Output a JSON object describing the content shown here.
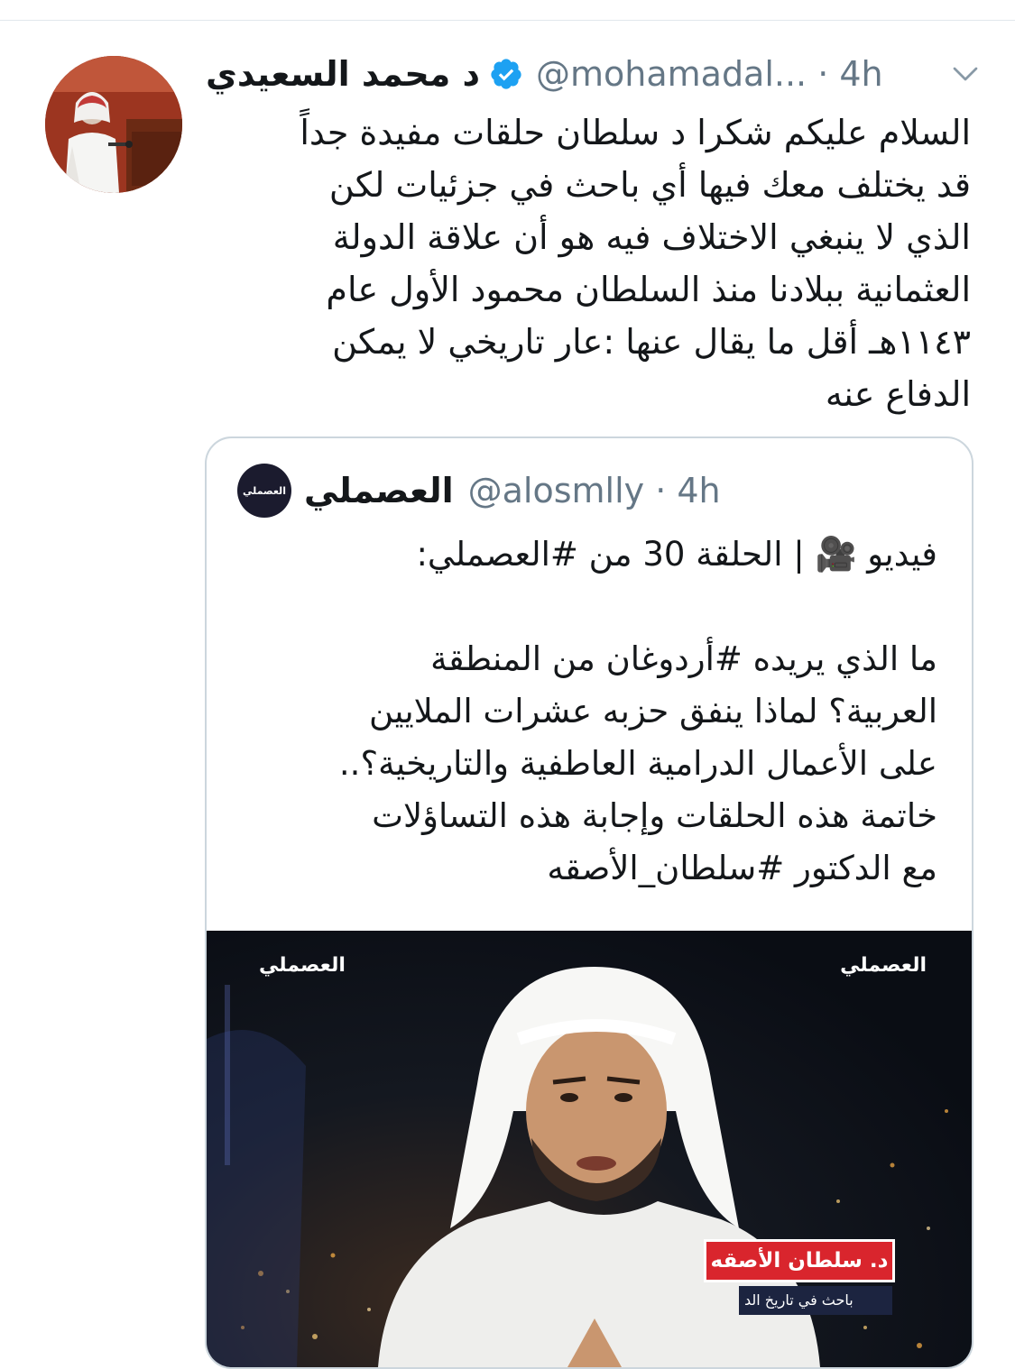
{
  "tweet": {
    "display_name": "د محمد السعيدي",
    "handle_time": "@mohamadal... · 4h",
    "text": "السلام عليكم شكرا د سلطان حلقات مفيدة جداً\nقد يختلف معك فيها أي باحث في جزئيات لكن\nالذي لا ينبغي الاختلاف فيه هو أن علاقة الدولة\nالعثمانية ببلادنا منذ السلطان محمود الأول عام\n١١٤٣هـ أقل ما يقال عنها :عار تاريخي لا يمكن\nالدفاع عنه",
    "verified_icon": "verified-badge-icon",
    "menu_icon": "chevron-down-icon"
  },
  "quote": {
    "display_name": "العصملي",
    "handle_time": "@alosmlly · 4h",
    "avatar_text": "العصملي",
    "text": "فيديو 🎥 | الحلقة 30 من #العصملي:\n\nما الذي يريده #أردوغان من المنطقة\nالعربية؟ لماذا ينفق حزبه عشرات الملايين\nعلى الأعمال الدرامية العاطفية والتاريخية؟..\nخاتمة هذه الحلقات وإجابة هذه التساؤلات\nمع الدكتور #سلطان_الأصقه",
    "media": {
      "logo_left": "العصملي",
      "logo_right": "العصملي",
      "lower_third_name": "د. سلطان الأصقه",
      "lower_third_sub": "باحث في تاريخ الد"
    }
  },
  "colors": {
    "text": "#14171a",
    "secondary": "#657786",
    "verified": "#1da1f2",
    "border": "#ccd6dd",
    "lower_third_red": "#d9252d"
  }
}
